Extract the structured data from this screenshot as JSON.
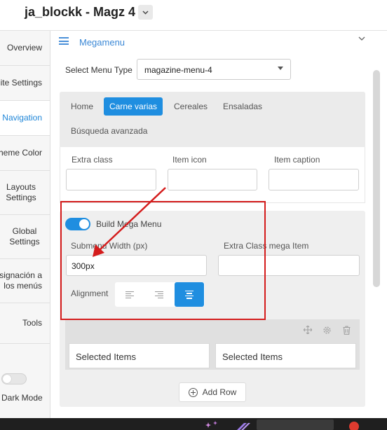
{
  "app": {
    "title": "ja_blockk - Magz 4"
  },
  "sidebar": {
    "items": [
      {
        "label": "Overview"
      },
      {
        "label": "ite Settings"
      },
      {
        "label": "Navigation"
      },
      {
        "label": "heme Color"
      },
      {
        "label": "Layouts Settings"
      },
      {
        "label": "Global Settings"
      },
      {
        "label": "signación a los menús"
      },
      {
        "label": "Tools"
      }
    ],
    "dark_mode_label": "Dark Mode"
  },
  "panel": {
    "title": "Megamenu",
    "menu_type_label": "Select Menu Type",
    "menu_type_value": "magazine-menu-4"
  },
  "menu_tabs": [
    {
      "label": "Home"
    },
    {
      "label": "Carne varias"
    },
    {
      "label": "Cereales"
    },
    {
      "label": "Ensaladas"
    },
    {
      "label": "Búsqueda avanzada"
    }
  ],
  "item_fields": {
    "extra_class_label": "Extra class",
    "item_icon_label": "Item icon",
    "item_caption_label": "Item caption"
  },
  "mega": {
    "build_label": "Build Mega Menu",
    "submenu_width_label": "Submenu Width (px)",
    "submenu_width_value": "300px",
    "extra_class_mega_label": "Extra Class mega Item",
    "alignment_label": "Alignment",
    "alignment_selected": "center",
    "columns": [
      {
        "label": "Selected Items"
      },
      {
        "label": "Selected Items"
      }
    ],
    "add_row_label": "Add Row"
  },
  "colors": {
    "accent": "#1f8ee0",
    "annotation": "#d41c1c",
    "active_nav": "#1f86d8"
  }
}
